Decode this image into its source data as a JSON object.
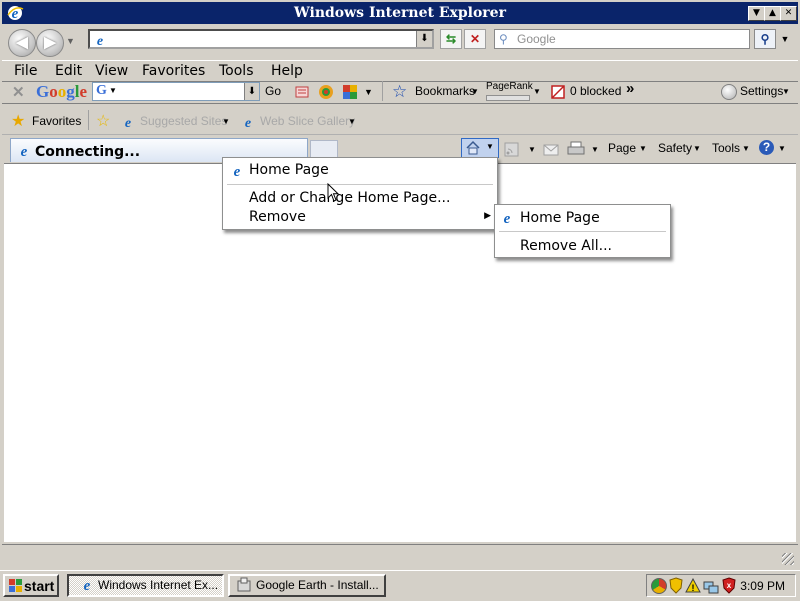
{
  "window": {
    "title": "Windows Internet Explorer"
  },
  "address_bar": {
    "value": ""
  },
  "search_box": {
    "placeholder": "Google"
  },
  "menubar": {
    "items": [
      "File",
      "Edit",
      "View",
      "Favorites",
      "Tools",
      "Help"
    ]
  },
  "google_toolbar": {
    "logo": "Google",
    "search_value": "G",
    "go_label": "Go",
    "bookmarks_label": "Bookmarks",
    "pagerank_label": "PageRank",
    "blocked_label": "0 blocked",
    "overflow": "»",
    "settings_label": "Settings"
  },
  "favorites_bar": {
    "favorites_label": "Favorites",
    "suggested_sites": "Suggested Sites",
    "web_slice_gallery": "Web Slice Gallery"
  },
  "tab": {
    "label": "Connecting..."
  },
  "command_bar": {
    "page": "Page",
    "safety": "Safety",
    "tools": "Tools"
  },
  "home_menu": {
    "items": [
      "Home Page",
      "Add or Change Home Page...",
      "Remove"
    ]
  },
  "remove_submenu": {
    "items": [
      "Home Page",
      "Remove All..."
    ]
  },
  "taskbar": {
    "start_label": "start",
    "buttons": [
      "Windows Internet Ex...",
      "Google Earth - Install..."
    ],
    "clock": "3:09 PM"
  },
  "colors": {
    "titlebar": "#0a246a",
    "chrome": "#d4d0c8",
    "ie_blue": "#1565c0"
  }
}
